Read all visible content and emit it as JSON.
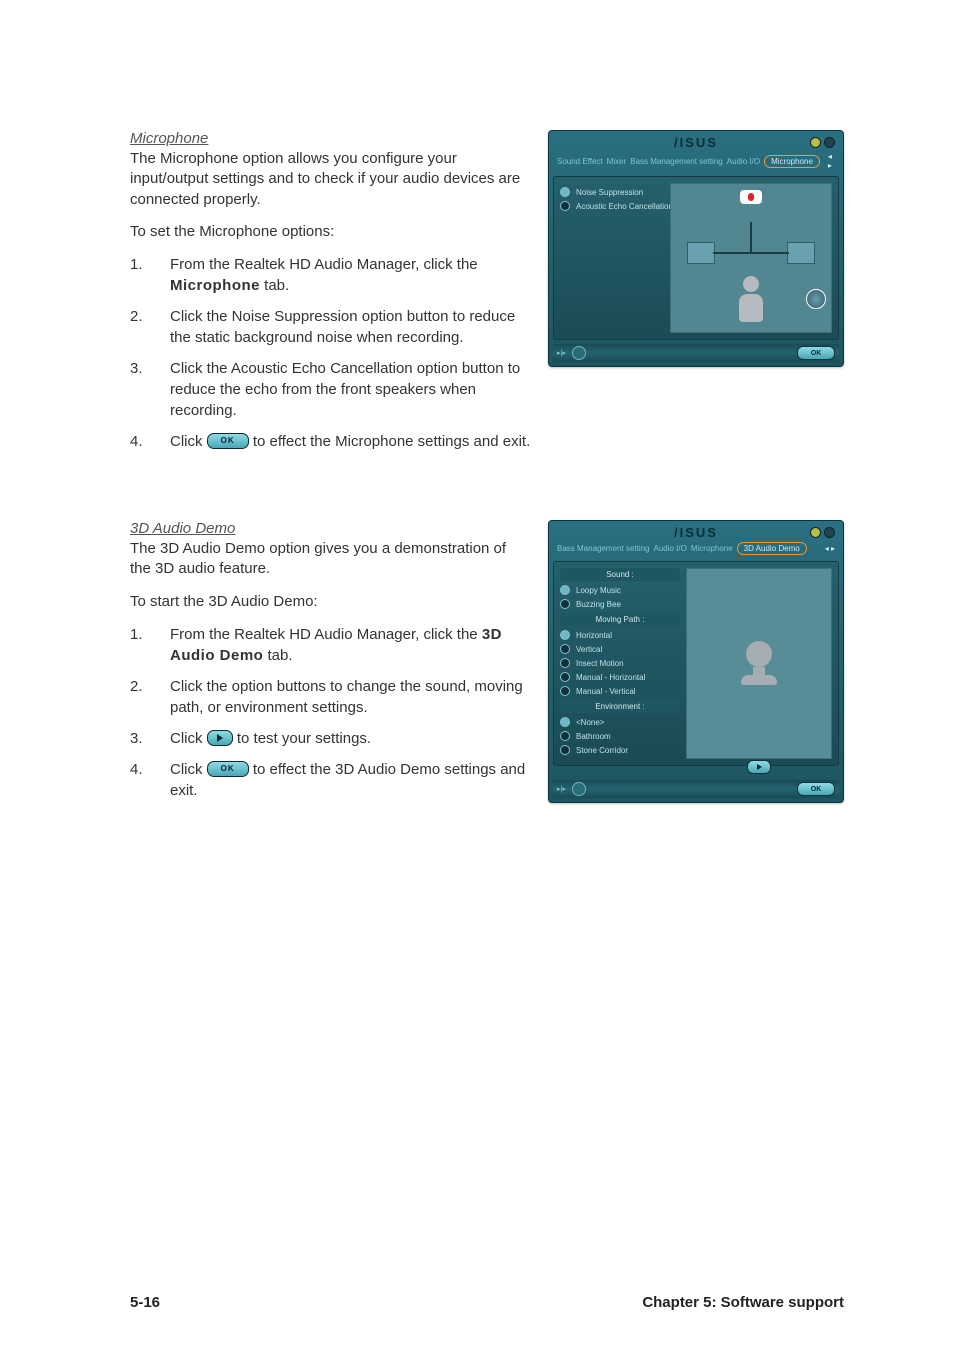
{
  "footer": {
    "page_number": "5-16",
    "chapter": "Chapter 5: Software support"
  },
  "microphone": {
    "heading": "Microphone",
    "intro": "The Microphone option allows you configure your input/output settings and to check if your audio devices are connected properly.",
    "to_set": "To set the Microphone options:",
    "steps": {
      "s1": {
        "num": "1.",
        "pre": "From the Realtek HD Audio Manager, click the ",
        "bold": "Microphone",
        "post": " tab."
      },
      "s2": {
        "num": "2.",
        "text": "Click the Noise Suppression option button to reduce the static background noise when recording."
      },
      "s3": {
        "num": "3.",
        "text": "Click the Acoustic Echo Cancellation option button to reduce the echo from the front speakers when recording."
      },
      "s4": {
        "num": "4.",
        "pre": "Click ",
        "post": " to effect the Microphone settings and exit."
      }
    },
    "screenshot": {
      "brand": "/ISUS",
      "tabs": {
        "t1": "Sound Effect",
        "t2": "Mixer",
        "t3": "Bass Management setting",
        "t4": "Audio I/O",
        "t5": "Microphone"
      },
      "opts": {
        "noise": "Noise Suppression",
        "echo": "Acoustic Echo Cancellation"
      },
      "ok": "OK"
    }
  },
  "demo3d": {
    "heading": "3D Audio Demo",
    "intro": "The 3D Audio Demo option gives you a demonstration of the 3D audio feature.",
    "to_start": "To start the 3D Audio Demo:",
    "steps": {
      "s1": {
        "num": "1.",
        "pre": "From the Realtek HD Audio Manager, click the ",
        "bold": "3D Audio Demo",
        "post": " tab."
      },
      "s2": {
        "num": "2.",
        "text": "Click the option buttons to change the sound, moving path, or environment settings."
      },
      "s3": {
        "num": "3.",
        "pre": "Click ",
        "post": " to test your settings."
      },
      "s4": {
        "num": "4.",
        "pre": "Click ",
        "post": " to effect the 3D Audio Demo settings and exit."
      }
    },
    "screenshot": {
      "brand": "/ISUS",
      "tabs": {
        "t1": "Bass Management setting",
        "t2": "Audio I/O",
        "t3": "Microphone",
        "t4": "3D Audio Demo"
      },
      "headers": {
        "sound": "Sound :",
        "path": "Moving Path :",
        "env": "Environment :"
      },
      "sound": {
        "o1": "Loopy Music",
        "o2": "Buzzing Bee"
      },
      "path": {
        "o1": "Horizontal",
        "o2": "Vertical",
        "o3": "Insect Motion",
        "o4": "Manual - Horizontal",
        "o5": "Manual - Vertical"
      },
      "env": {
        "o1": "<None>",
        "o2": "Bathroom",
        "o3": "Stone Corridor"
      },
      "ok": "OK"
    }
  },
  "inline": {
    "ok": "OK"
  }
}
